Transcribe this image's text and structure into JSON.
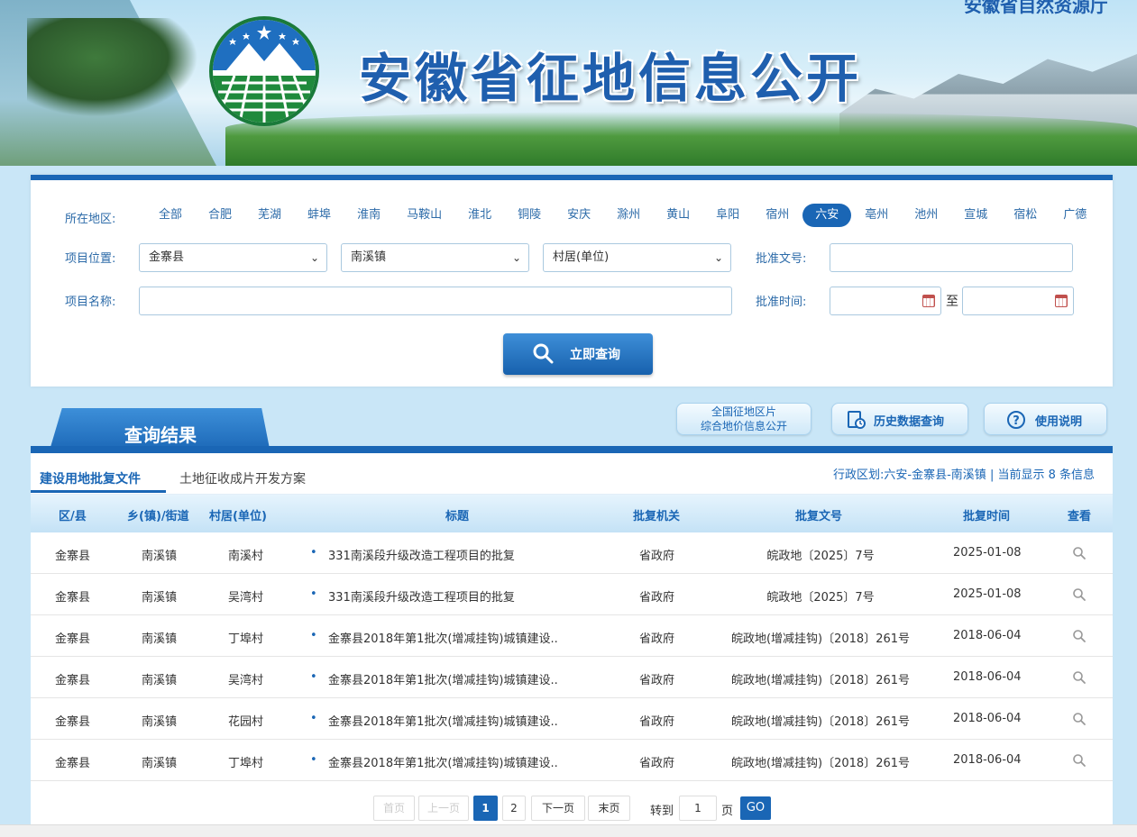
{
  "header": {
    "site_title": "安徽省征地信息公开",
    "department": "安徽省自然资源厅"
  },
  "search": {
    "region_label": "所在地区:",
    "regions": [
      "全部",
      "合肥",
      "芜湖",
      "蚌埠",
      "淮南",
      "马鞍山",
      "淮北",
      "铜陵",
      "安庆",
      "滁州",
      "黄山",
      "阜阳",
      "宿州",
      "六安",
      "亳州",
      "池州",
      "宣城",
      "宿松",
      "广德"
    ],
    "active_region": "六安",
    "location_label": "项目位置:",
    "county": "金寨县",
    "town": "南溪镇",
    "village_placeholder": "村居(单位)",
    "approval_no_label": "批准文号:",
    "approval_no_value": "",
    "project_name_label": "项目名称:",
    "project_name_value": "",
    "approval_time_label": "批准时间:",
    "date_to": "至",
    "submit_label": "立即查询"
  },
  "tools": {
    "national_line1": "全国征地区片",
    "national_line2": "综合地价信息公开",
    "history": "历史数据查询",
    "help": "使用说明"
  },
  "results": {
    "section_title": "查询结果",
    "tabs": [
      "建设用地批复文件",
      "土地征收成片开发方案"
    ],
    "info": "行政区划:六安-金寨县-南溪镇 | 当前显示 8 条信息",
    "columns": [
      "区/县",
      "乡(镇)/街道",
      "村居(单位)",
      "标题",
      "批复机关",
      "批复文号",
      "批复时间",
      "查看"
    ],
    "rows": [
      {
        "county": "金寨县",
        "town": "南溪镇",
        "village": "南溪村",
        "title": "331南溪段升级改造工程项目的批复",
        "authority": "省政府",
        "doc_no": "皖政地〔2025〕7号",
        "date": "2025-01-08"
      },
      {
        "county": "金寨县",
        "town": "南溪镇",
        "village": "吴湾村",
        "title": "331南溪段升级改造工程项目的批复",
        "authority": "省政府",
        "doc_no": "皖政地〔2025〕7号",
        "date": "2025-01-08"
      },
      {
        "county": "金寨县",
        "town": "南溪镇",
        "village": "丁埠村",
        "title": "金寨县2018年第1批次(增减挂钩)城镇建设..",
        "authority": "省政府",
        "doc_no": "皖政地(增减挂钩)〔2018〕261号",
        "date": "2018-06-04"
      },
      {
        "county": "金寨县",
        "town": "南溪镇",
        "village": "吴湾村",
        "title": "金寨县2018年第1批次(增减挂钩)城镇建设..",
        "authority": "省政府",
        "doc_no": "皖政地(增减挂钩)〔2018〕261号",
        "date": "2018-06-04"
      },
      {
        "county": "金寨县",
        "town": "南溪镇",
        "village": "花园村",
        "title": "金寨县2018年第1批次(增减挂钩)城镇建设..",
        "authority": "省政府",
        "doc_no": "皖政地(增减挂钩)〔2018〕261号",
        "date": "2018-06-04"
      },
      {
        "county": "金寨县",
        "town": "南溪镇",
        "village": "丁埠村",
        "title": "金寨县2018年第1批次(增减挂钩)城镇建设..",
        "authority": "省政府",
        "doc_no": "皖政地(增减挂钩)〔2018〕261号",
        "date": "2018-06-04"
      }
    ]
  },
  "pager": {
    "first": "首页",
    "prev": "上一页",
    "pages": [
      "1",
      "2"
    ],
    "current": "1",
    "next": "下一页",
    "last": "末页",
    "goto_label": "转到",
    "goto_value": "1",
    "page_unit": "页",
    "go_label": "GO"
  },
  "colors": {
    "primary": "#1a66b5",
    "page_bg": "#c9e6f7",
    "label": "#2b6aa8"
  }
}
